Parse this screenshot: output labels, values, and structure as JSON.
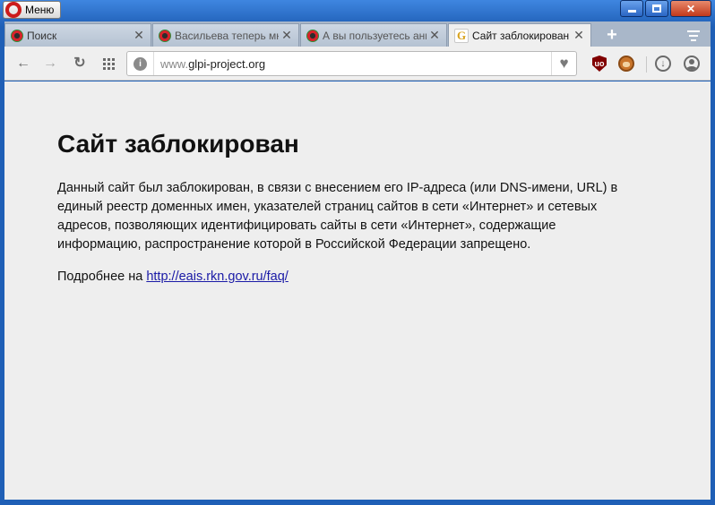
{
  "window": {
    "menu_label": "Меню",
    "minimize": "–",
    "maximize": "□",
    "close": "✕"
  },
  "tabs": [
    {
      "label": "Поиск",
      "icon": "opera-speed-icon",
      "active": false
    },
    {
      "label": "Васильева теперь мне",
      "icon": "opera-speed-icon",
      "active": false
    },
    {
      "label": "А вы пользуетесь анг",
      "icon": "opera-speed-icon",
      "active": false
    },
    {
      "label": "Сайт заблокирован",
      "icon": "glpi-favicon",
      "active": true
    }
  ],
  "tab_close": "✕",
  "new_tab": "+",
  "address": {
    "prefix": "www.",
    "domain": "glpi-project.org"
  },
  "toolbar": {
    "back": "←",
    "forward": "→",
    "reload": "↻",
    "info": "i",
    "heart": "♥",
    "ublock": "uo"
  },
  "page": {
    "title": "Сайт заблокирован",
    "body": "Данный сайт был заблокирован, в связи с внесением его IP-адреса (или DNS-имени, URL) в единый реестр доменных имен, указателей страниц сайтов в сети «Интернет» и сетевых адресов, позволяющих идентифицировать сайты в сети «Интернет», содержащие информацию, распространение которой в Российской Федерации запрещено.",
    "more_prefix": "Подробнее на ",
    "more_link": "http://eais.rkn.gov.ru/faq/"
  }
}
